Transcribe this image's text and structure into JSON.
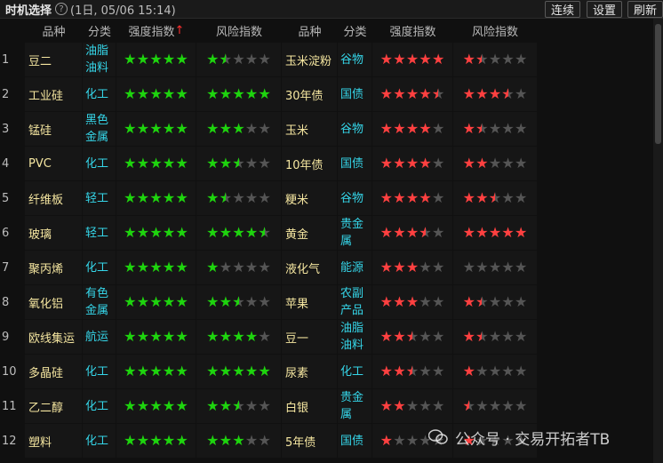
{
  "title": "时机选择",
  "subtitle": "(1日, 05/06 15:14)",
  "buttons": {
    "continue": "连续",
    "settings": "设置",
    "refresh": "刷新"
  },
  "headers": {
    "variety": "品种",
    "category": "分类",
    "strength": "强度指数",
    "strength_arrow": "↑",
    "risk": "风险指数"
  },
  "rows": [
    {
      "idx": "1",
      "left": {
        "name": "豆二",
        "cat": "油脂油料",
        "strength": 5,
        "risk": 1.5
      },
      "right": {
        "name": "玉米淀粉",
        "cat": "谷物",
        "strength": 5,
        "risk": 1.5
      }
    },
    {
      "idx": "2",
      "left": {
        "name": "工业硅",
        "cat": "化工",
        "strength": 5,
        "risk": 5
      },
      "right": {
        "name": "30年债",
        "cat": "国债",
        "strength": 4.5,
        "risk": 3.5
      }
    },
    {
      "idx": "3",
      "left": {
        "name": "锰硅",
        "cat": "黑色金属",
        "strength": 5,
        "risk": 3
      },
      "right": {
        "name": "玉米",
        "cat": "谷物",
        "strength": 4,
        "risk": 1.5
      }
    },
    {
      "idx": "4",
      "left": {
        "name": "PVC",
        "cat": "化工",
        "strength": 5,
        "risk": 2.5
      },
      "right": {
        "name": "10年债",
        "cat": "国债",
        "strength": 4,
        "risk": 2
      }
    },
    {
      "idx": "5",
      "left": {
        "name": "纤维板",
        "cat": "轻工",
        "strength": 5,
        "risk": 1.5
      },
      "right": {
        "name": "粳米",
        "cat": "谷物",
        "strength": 4,
        "risk": 2.5
      }
    },
    {
      "idx": "6",
      "left": {
        "name": "玻璃",
        "cat": "轻工",
        "strength": 5,
        "risk": 4.5
      },
      "right": {
        "name": "黄金",
        "cat": "贵金属",
        "strength": 3.5,
        "risk": 5
      }
    },
    {
      "idx": "7",
      "left": {
        "name": "聚丙烯",
        "cat": "化工",
        "strength": 5,
        "risk": 1
      },
      "right": {
        "name": "液化气",
        "cat": "能源",
        "strength": 3,
        "risk": 0
      }
    },
    {
      "idx": "8",
      "left": {
        "name": "氧化铝",
        "cat": "有色金属",
        "strength": 5,
        "risk": 2.5
      },
      "right": {
        "name": "苹果",
        "cat": "农副产品",
        "strength": 3,
        "risk": 1.5
      }
    },
    {
      "idx": "9",
      "left": {
        "name": "欧线集运",
        "cat": "航运",
        "strength": 5,
        "risk": 4
      },
      "right": {
        "name": "豆一",
        "cat": "油脂油料",
        "strength": 2.5,
        "risk": 1.5
      }
    },
    {
      "idx": "10",
      "left": {
        "name": "多晶硅",
        "cat": "化工",
        "strength": 5,
        "risk": 5
      },
      "right": {
        "name": "尿素",
        "cat": "化工",
        "strength": 2.5,
        "risk": 1
      }
    },
    {
      "idx": "11",
      "left": {
        "name": "乙二醇",
        "cat": "化工",
        "strength": 5,
        "risk": 2.5
      },
      "right": {
        "name": "白银",
        "cat": "贵金属",
        "strength": 2,
        "risk": 0.5
      }
    },
    {
      "idx": "12",
      "left": {
        "name": "塑料",
        "cat": "化工",
        "strength": 5,
        "risk": 3
      },
      "right": {
        "name": "5年债",
        "cat": "国债",
        "strength": 1,
        "risk": 1
      }
    }
  ],
  "watermark": "公众号 · 交易开拓者TB",
  "colors": {
    "green_star": "#1ed40e",
    "red_star": "#ff4040",
    "empty_star": "#555555",
    "name_text": "#f5e6a0",
    "category_text": "#35d5e8"
  }
}
